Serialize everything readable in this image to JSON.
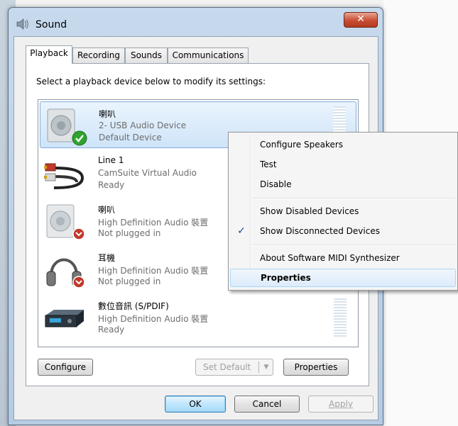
{
  "window": {
    "title": "Sound",
    "close_glyph": "✕"
  },
  "tabs": [
    {
      "label": "Playback",
      "active": true
    },
    {
      "label": "Recording"
    },
    {
      "label": "Sounds"
    },
    {
      "label": "Communications"
    }
  ],
  "playback": {
    "instruction": "Select a playback device below to modify its settings:",
    "devices": [
      {
        "name": "喇叭",
        "description": "2- USB Audio Device",
        "status": "Default Device",
        "icon": "speaker-icon",
        "badge": "default-check-icon"
      },
      {
        "name": "Line 1",
        "description": "CamSuite Virtual Audio",
        "status": "Ready",
        "icon": "rca-cable-icon"
      },
      {
        "name": "喇叭",
        "description": "High Definition Audio 裝置",
        "status": "Not plugged in",
        "icon": "speaker-icon",
        "badge": "unplugged-icon"
      },
      {
        "name": "耳機",
        "description": "High Definition Audio 裝置",
        "status": "Not plugged in",
        "icon": "headphones-icon",
        "badge": "unplugged-icon"
      },
      {
        "name": "數位音訊 (S/PDIF)",
        "description": "High Definition Audio 裝置",
        "status": "Ready",
        "icon": "spdif-device-icon"
      }
    ],
    "buttons": {
      "configure": "Configure",
      "set_default": "Set Default",
      "properties": "Properties"
    }
  },
  "dialog_buttons": {
    "ok": "OK",
    "cancel": "Cancel",
    "apply": "Apply"
  },
  "context_menu": {
    "items": [
      {
        "label": "Configure Speakers"
      },
      {
        "label": "Test"
      },
      {
        "label": "Disable"
      },
      {
        "label": "Show Disabled Devices"
      },
      {
        "label": "Show Disconnected Devices",
        "checked": true
      },
      {
        "label": "About Software MIDI Synthesizer"
      },
      {
        "label": "Properties",
        "bold": true
      }
    ],
    "check_glyph": "✓"
  },
  "colors": {
    "accent": "#3c7fb1",
    "selection": "#cfe4f9",
    "close_red": "#c74e35"
  }
}
